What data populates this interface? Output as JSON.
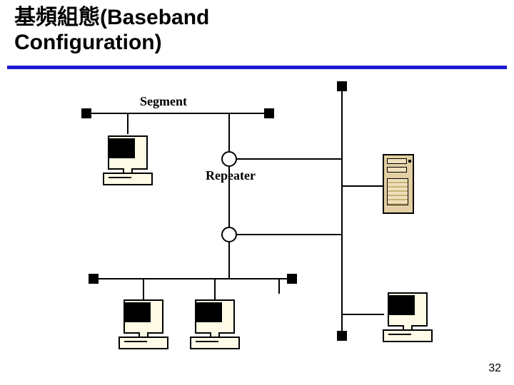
{
  "title_line1": "基頻組態(Baseband",
  "title_line2": "Configuration)",
  "labels": {
    "segment": "Segment",
    "repeater": "Repeater"
  },
  "page_number": "32"
}
